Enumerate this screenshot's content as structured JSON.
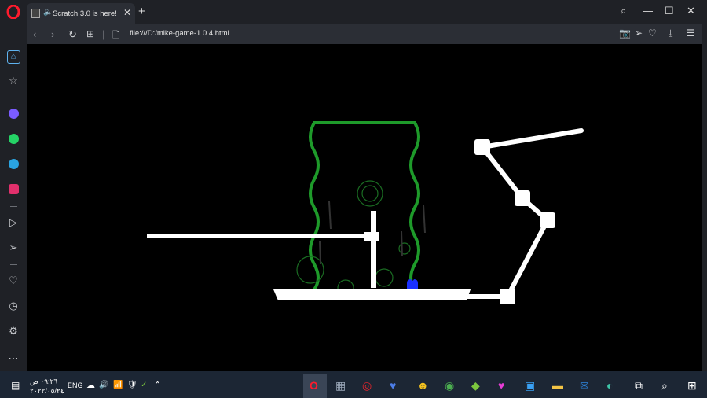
{
  "browser": {
    "tab_title": "Scratch 3.0 is here!",
    "tab_close": "✕",
    "new_tab": "+",
    "url": "file:///D:/mike-game-1.0.4.html",
    "window_controls": {
      "search": "⌕",
      "minimize": "—",
      "maximize": "☐",
      "close": "✕"
    },
    "nav": {
      "back": "‹",
      "forward": "›",
      "reload": "↻",
      "tabs": "⊞",
      "page": "🗋"
    },
    "toolbar_icons": [
      "camera-icon",
      "send-icon",
      "heart-icon",
      "download-icon",
      "menu-icon"
    ],
    "toolbar_glyphs": [
      "📷",
      "➢",
      "♡",
      "⤓",
      "☰"
    ]
  },
  "sidebar": {
    "items": [
      {
        "name": "home-icon",
        "glyph": "⌂",
        "color": "#5fb3f0"
      },
      {
        "name": "bookmarks-icon",
        "glyph": "☆",
        "color": "#c8cace"
      },
      {
        "name": "messenger-icon",
        "glyph": "",
        "color": "#7b5cff"
      },
      {
        "name": "whatsapp-icon",
        "glyph": "",
        "color": "#25d366"
      },
      {
        "name": "telegram-icon",
        "glyph": "",
        "color": "#2aa3e0"
      },
      {
        "name": "instagram-icon",
        "glyph": "",
        "color": "#e1306c"
      },
      {
        "name": "player-icon",
        "glyph": "▷",
        "color": "#c8cace"
      },
      {
        "name": "send-icon",
        "glyph": "➢",
        "color": "#c8cace"
      },
      {
        "name": "heart-icon",
        "glyph": "♡",
        "color": "#c8cace"
      },
      {
        "name": "history-icon",
        "glyph": "◷",
        "color": "#c8cace"
      },
      {
        "name": "settings-icon",
        "glyph": "⚙",
        "color": "#c8cace"
      },
      {
        "name": "more-icon",
        "glyph": "⋯",
        "color": "#c8cace"
      }
    ]
  },
  "taskbar": {
    "clock_time": "٠٩:٢٦ ص",
    "clock_date": "٢٠٢٢/٠٥/٢٤",
    "language": "ENG",
    "tray_glyphs": [
      "☁",
      "🔊",
      "📶",
      "🛡",
      "✓",
      "⌃"
    ],
    "apps": [
      {
        "name": "opera-app-icon",
        "glyph": "O",
        "color": "#ff1b2d"
      },
      {
        "name": "calculator-app-icon",
        "glyph": "▦",
        "color": "#9aa7b8"
      },
      {
        "name": "target-app-icon",
        "glyph": "◎",
        "color": "#e0242c"
      },
      {
        "name": "heart-app-icon",
        "glyph": "♥",
        "color": "#4d7ee8"
      },
      {
        "name": "emoji-app-icon",
        "glyph": "☻",
        "color": "#f4c21f"
      },
      {
        "name": "chrome-app-icon",
        "glyph": "◉",
        "color": "#4caf50"
      },
      {
        "name": "bluestacks-app-icon",
        "glyph": "◆",
        "color": "#7cc63e"
      },
      {
        "name": "heart-pink-app-icon",
        "glyph": "♥",
        "color": "#e83dd6"
      },
      {
        "name": "store-app-icon",
        "glyph": "▣",
        "color": "#3aa0f2"
      },
      {
        "name": "folder-app-icon",
        "glyph": "▬",
        "color": "#f3c445"
      },
      {
        "name": "mail-app-icon",
        "glyph": "✉",
        "color": "#2e86de"
      },
      {
        "name": "edge-app-icon",
        "glyph": "◐",
        "color": "#3ec6a8"
      },
      {
        "name": "taskview-app-icon",
        "glyph": "⧉",
        "color": "#ffffff"
      },
      {
        "name": "search-app-icon",
        "glyph": "⌕",
        "color": "#ffffff"
      },
      {
        "name": "start-app-icon",
        "glyph": "⊞",
        "color": "#ffffff"
      }
    ]
  },
  "colors": {
    "chrome_bg": "#1f2126",
    "tab_bg": "#2b2e35",
    "taskbar_bg": "#1c2634",
    "vine": "#1e9a2a",
    "player": "#1a30ff"
  }
}
